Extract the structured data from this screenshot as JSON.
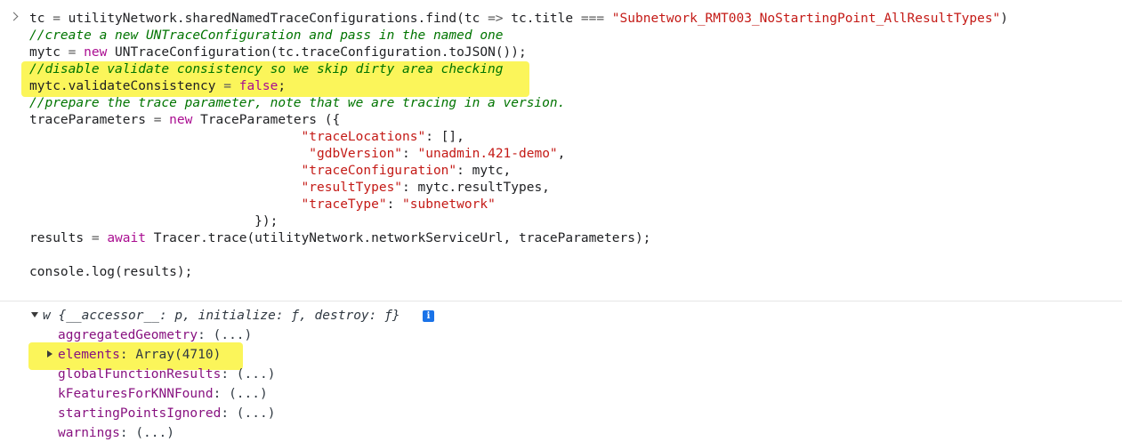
{
  "console": {
    "code_lines": [
      [
        {
          "t": "tc ",
          "c": "plain"
        },
        {
          "t": "=",
          "c": "op"
        },
        {
          "t": " utilityNetwork.sharedNamedTraceConfigurations.find(tc ",
          "c": "plain"
        },
        {
          "t": "=>",
          "c": "op"
        },
        {
          "t": " tc.title ",
          "c": "plain"
        },
        {
          "t": "===",
          "c": "op"
        },
        {
          "t": " ",
          "c": "plain"
        },
        {
          "t": "\"Subnetwork_RMT003_NoStartingPoint_AllResultTypes\"",
          "c": "str"
        },
        {
          "t": ")",
          "c": "plain"
        }
      ],
      [
        {
          "t": "//create a new UNTraceConfiguration and pass in the named one",
          "c": "cm"
        }
      ],
      [
        {
          "t": "mytc ",
          "c": "plain"
        },
        {
          "t": "=",
          "c": "op"
        },
        {
          "t": " ",
          "c": "plain"
        },
        {
          "t": "new",
          "c": "kw"
        },
        {
          "t": " UNTraceConfiguration(tc.traceConfiguration.toJSON());",
          "c": "plain"
        }
      ],
      [
        {
          "t": "//disable validate consistency so we skip dirty area checking",
          "c": "cm"
        }
      ],
      [
        {
          "t": "mytc.validateConsistency ",
          "c": "plain"
        },
        {
          "t": "=",
          "c": "op"
        },
        {
          "t": " ",
          "c": "plain"
        },
        {
          "t": "false",
          "c": "kw"
        },
        {
          "t": ";",
          "c": "plain"
        }
      ],
      [
        {
          "t": "//prepare the trace parameter, note that we are tracing in a version.",
          "c": "cm"
        }
      ],
      [
        {
          "t": "traceParameters ",
          "c": "plain"
        },
        {
          "t": "=",
          "c": "op"
        },
        {
          "t": " ",
          "c": "plain"
        },
        {
          "t": "new",
          "c": "kw"
        },
        {
          "t": " TraceParameters ({",
          "c": "plain"
        }
      ],
      [
        {
          "t": "                                   ",
          "c": "plain"
        },
        {
          "t": "\"traceLocations\"",
          "c": "str"
        },
        {
          "t": ": [],",
          "c": "plain"
        }
      ],
      [
        {
          "t": "                                    ",
          "c": "plain"
        },
        {
          "t": "\"gdbVersion\"",
          "c": "str"
        },
        {
          "t": ": ",
          "c": "plain"
        },
        {
          "t": "\"unadmin.421-demo\"",
          "c": "str"
        },
        {
          "t": ",",
          "c": "plain"
        }
      ],
      [
        {
          "t": "                                   ",
          "c": "plain"
        },
        {
          "t": "\"traceConfiguration\"",
          "c": "str"
        },
        {
          "t": ": mytc,",
          "c": "plain"
        }
      ],
      [
        {
          "t": "                                   ",
          "c": "plain"
        },
        {
          "t": "\"resultTypes\"",
          "c": "str"
        },
        {
          "t": ": mytc.resultTypes,",
          "c": "plain"
        }
      ],
      [
        {
          "t": "                                   ",
          "c": "plain"
        },
        {
          "t": "\"traceType\"",
          "c": "str"
        },
        {
          "t": ": ",
          "c": "plain"
        },
        {
          "t": "\"subnetwork\"",
          "c": "str"
        }
      ],
      [
        {
          "t": "                             });",
          "c": "plain"
        }
      ],
      [
        {
          "t": "results ",
          "c": "plain"
        },
        {
          "t": "=",
          "c": "op"
        },
        {
          "t": " ",
          "c": "plain"
        },
        {
          "t": "await",
          "c": "kw"
        },
        {
          "t": " Tracer.trace(utilityNetwork.networkServiceUrl, traceParameters);",
          "c": "plain"
        }
      ],
      [
        {
          "t": "",
          "c": "plain"
        }
      ],
      [
        {
          "t": "console.log(results);",
          "c": "plain"
        }
      ]
    ],
    "result": {
      "summary": "w {__accessor__: p, initialize: ƒ, destroy: ƒ}",
      "info_badge": "i",
      "properties": [
        {
          "key": "aggregatedGeometry",
          "value": "(...)"
        },
        {
          "key": "elements",
          "value": "Array(4710)"
        },
        {
          "key": "globalFunctionResults",
          "value": "(...)"
        },
        {
          "key": "kFeaturesForKNNFound",
          "value": "(...)"
        },
        {
          "key": "startingPointsIgnored",
          "value": "(...)"
        },
        {
          "key": "warnings",
          "value": "(...)"
        }
      ]
    }
  },
  "colors": {
    "highlight": "#fbf55a",
    "string": "#c41a16",
    "keyword": "#aa0d91",
    "comment": "#007400",
    "property_key": "#881280",
    "info_badge": "#1a73e8"
  }
}
